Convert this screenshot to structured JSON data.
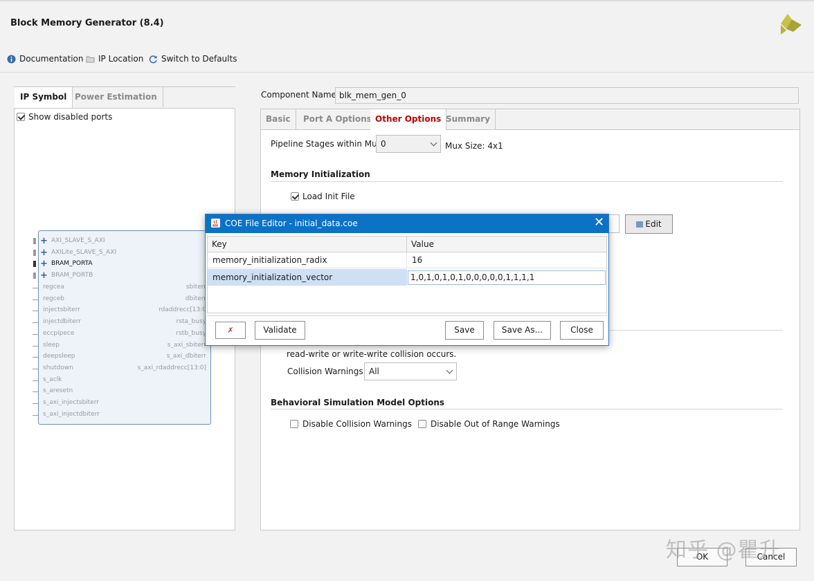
{
  "window": {
    "title": "Block Memory Generator (8.4)"
  },
  "toolbar": {
    "documentation": "Documentation",
    "ip_location": "IP Location",
    "switch_defaults": "Switch to Defaults"
  },
  "left_tabs": {
    "ip_symbol": "IP Symbol",
    "power_estimation": "Power Estimation"
  },
  "show_disabled_ports": "Show disabled ports",
  "ip_symbol": {
    "bus_ports": [
      {
        "label": "AXI_SLAVE_S_AXI",
        "enabled": false
      },
      {
        "label": "AXILite_SLAVE_S_AXI",
        "enabled": false
      },
      {
        "label": "BRAM_PORTA",
        "enabled": true
      },
      {
        "label": "BRAM_PORTB",
        "enabled": false
      }
    ],
    "left_ports": [
      "regcea",
      "regceb",
      "injectsbiterr",
      "injectdbiterr",
      "eccpipece",
      "sleep",
      "deepsleep",
      "shutdown",
      "s_aclk",
      "s_aresetn",
      "s_axi_injectsbiterr",
      "s_axi_injectdbiterr"
    ],
    "right_ports": [
      "sbiterr",
      "dbiterr",
      "rdaddrecc[13:0",
      "rsta_busy",
      "rstb_busy",
      "s_axi_sbiterr",
      "s_axi_dbiterr",
      "s_axi_rdaddrecc[13:0]"
    ]
  },
  "component": {
    "label": "Component Name",
    "value": "blk_mem_gen_0"
  },
  "right_tabs": {
    "basic": "Basic",
    "port_a": "Port A Options",
    "other": "Other Options",
    "summary": "Summary"
  },
  "other_options": {
    "pipeline_label": "Pipeline Stages within Mux",
    "pipeline_value": "0",
    "mux_size": "Mux Size: 4x1",
    "mem_init_title": "Memory Initialization",
    "load_init_file": "Load Init File",
    "edit_button": "Edit",
    "collision_text": "read-write or write-write collision occurs.",
    "collision_warnings_label": "Collision Warnings",
    "collision_warnings_value": "All",
    "behavioral_title": "Behavioral Simulation Model Options",
    "disable_collision": "Disable Collision Warnings",
    "disable_out_of_range": "Disable Out of Range Warnings"
  },
  "dialog": {
    "title": "COE File Editor - initial_data.coe",
    "headers": {
      "key": "Key",
      "value": "Value"
    },
    "rows": [
      {
        "key": "memory_initialization_radix",
        "value": "16"
      },
      {
        "key": "memory_initialization_vector",
        "value": "1,0,1,0,1,0,1,0,0,0,0,0,1,1,1,1"
      }
    ],
    "validate": "Validate",
    "save": "Save",
    "save_as": "Save As...",
    "close": "Close"
  },
  "buttons": {
    "ok": "OK",
    "cancel": "Cancel"
  },
  "watermark": "知乎 @瞿升"
}
